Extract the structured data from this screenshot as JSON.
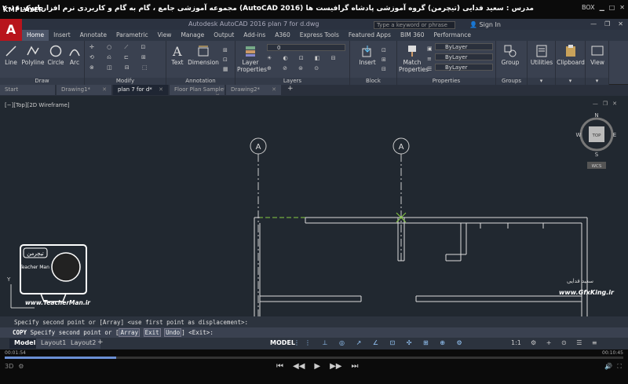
{
  "player": {
    "logo": "KMPLAYER",
    "title": "مجموعه آموزشی جامع ، گام به گام و کاربردی نرم افزار اتوکد ۲۰۱۶ (AutoCAD 2016)   مدرس : سعید فدایی (تیچرمن) گروه آموزشی پادشاه گرافیست ها",
    "right_label": "BOX",
    "time_left": "00:01:54",
    "time_right": "00:10:45",
    "progress": 0.18,
    "controls": [
      "prev",
      "rewind",
      "play",
      "forward",
      "next"
    ],
    "control_glyphs": [
      "⏮",
      "◀◀",
      "▶",
      "▶▶",
      "⏭"
    ]
  },
  "acad": {
    "logo": "A",
    "title": "Autodesk AutoCAD 2016   plan 7 for d.dwg",
    "search_placeholder": "Type a keyword or phrase",
    "signin": "Sign In",
    "ribbon_tabs": [
      "Home",
      "Insert",
      "Annotate",
      "Parametric",
      "View",
      "Manage",
      "Output",
      "Add-ins",
      "A360",
      "Express Tools",
      "Featured Apps",
      "BIM 360",
      "Performance"
    ],
    "active_tab": "Home",
    "panels": {
      "draw": {
        "label": "Draw",
        "tools": [
          "Line",
          "Polyline",
          "Circle",
          "Arc"
        ]
      },
      "modify": {
        "label": "Modify"
      },
      "annotation": {
        "label": "Annotation",
        "tools": [
          "Text",
          "Dimension"
        ]
      },
      "layers": {
        "label": "Layers",
        "tools": [
          "Layer Properties"
        ],
        "layer_value": "0"
      },
      "block": {
        "label": "Block",
        "tools": [
          "Insert"
        ]
      },
      "properties": {
        "label": "Properties",
        "tools": [
          "Match Properties"
        ],
        "combos": [
          "ByLayer",
          "ByLayer",
          "ByLayer"
        ]
      },
      "groups": {
        "label": "Groups",
        "tools": [
          "Group"
        ]
      },
      "utilities": {
        "tools": [
          "Utilities"
        ]
      },
      "clipboard": {
        "tools": [
          "Clipboard"
        ]
      },
      "view": {
        "tools": [
          "View"
        ]
      }
    },
    "file_tabs": [
      {
        "label": "Start",
        "active": false
      },
      {
        "label": "Drawing1*",
        "active": false
      },
      {
        "label": "plan 7 for d*",
        "active": true
      },
      {
        "label": "Floor Plan Sample*",
        "active": false
      },
      {
        "label": "Drawing2*",
        "active": false
      }
    ],
    "viewport_label": "[−][Top][2D Wireframe]",
    "viewcube": {
      "top": "TOP",
      "n": "N",
      "s": "S",
      "e": "E",
      "w": "W",
      "ucs": "WCS"
    },
    "grid_labels": [
      "A",
      "A"
    ],
    "command_history": "Specify second point or [Array] <use first point as displacement>:",
    "command_line": {
      "prefix": "COPY",
      "text": " Specify second point or [",
      "opts": [
        "Array",
        "Exit",
        "Undo"
      ],
      "suffix": "] <Exit>:"
    },
    "layout_tabs": [
      "Model",
      "Layout1",
      "Layout2"
    ],
    "active_layout": "Model",
    "status_model": "MODEL",
    "scale": "1:1"
  },
  "watermarks": {
    "left_logo_text": "تیچرمن",
    "left_logo_sub": "Teacher Man",
    "left_url": "www.TeacherMan.ir",
    "right_name": "سعید فدایی",
    "right_url": "www.GfxKing.ir"
  }
}
